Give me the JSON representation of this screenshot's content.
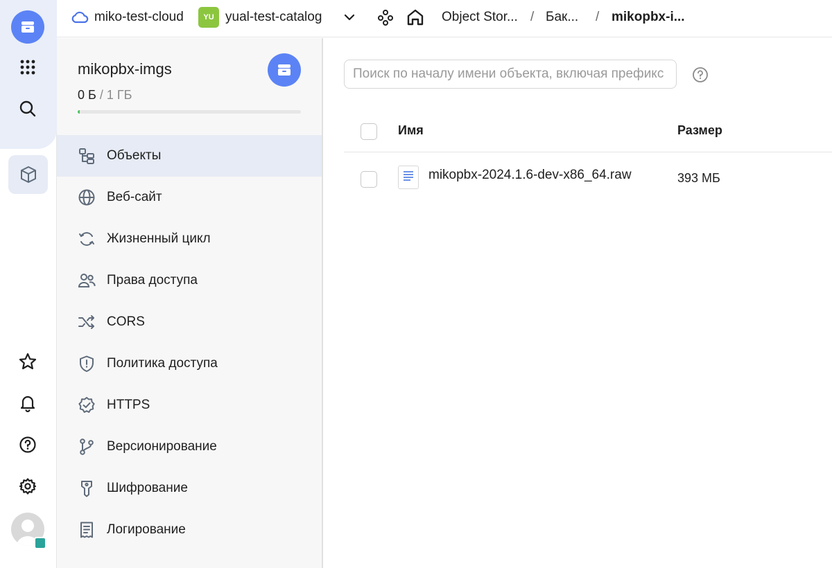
{
  "topbar": {
    "cloud_name": "miko-test-cloud",
    "catalog_badge": "YU",
    "catalog_name": "yual-test-catalog",
    "breadcrumbs": [
      "Object Stor...",
      "Бак...",
      "mikopbx-i..."
    ],
    "separator": "/"
  },
  "bucket": {
    "name": "mikopbx-imgs",
    "used": "0 Б",
    "quota_sep": "/",
    "total": "1 ГБ",
    "usage_fraction": 0.01
  },
  "sidebar": {
    "items": [
      {
        "label": "Объекты",
        "icon": "objects-icon",
        "active": true
      },
      {
        "label": "Веб-сайт",
        "icon": "globe-icon"
      },
      {
        "label": "Жизненный цикл",
        "icon": "lifecycle-icon"
      },
      {
        "label": "Права доступа",
        "icon": "users-icon"
      },
      {
        "label": "CORS",
        "icon": "shuffle-icon"
      },
      {
        "label": "Политика доступа",
        "icon": "shield-icon"
      },
      {
        "label": "HTTPS",
        "icon": "badge-check-icon"
      },
      {
        "label": "Версионирование",
        "icon": "branch-icon"
      },
      {
        "label": "Шифрование",
        "icon": "key-icon"
      },
      {
        "label": "Логирование",
        "icon": "receipt-icon"
      }
    ]
  },
  "search": {
    "placeholder": "Поиск по началу имени объекта, включая префикс"
  },
  "table": {
    "columns": {
      "name": "Имя",
      "size": "Размер"
    },
    "rows": [
      {
        "name": "mikopbx-2024.1.6-dev-x86_64.raw",
        "size": "393 МБ"
      }
    ]
  },
  "colors": {
    "accent": "#5b83f5",
    "active_bg": "#e6ebf5",
    "catalog_badge": "#8cc63f",
    "progress": "#4fc264"
  }
}
